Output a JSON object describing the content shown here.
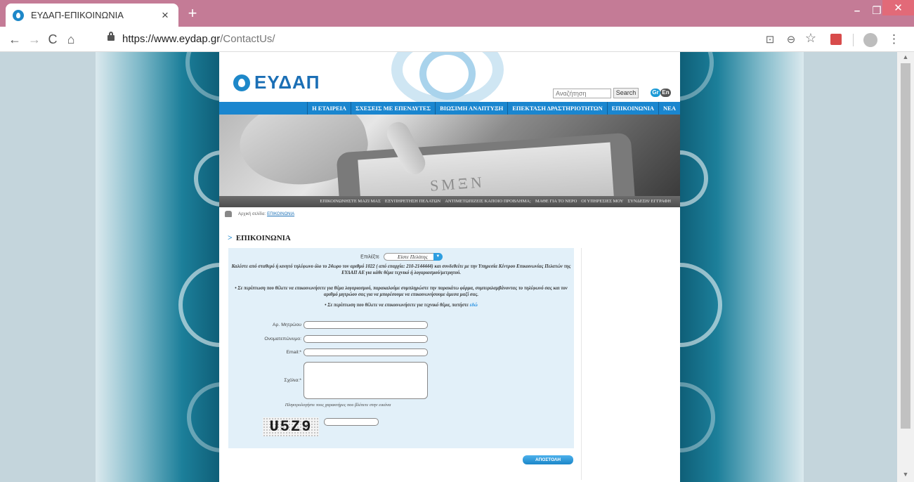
{
  "browser": {
    "tab_title": "ΕΥΔΑΠ-ΕΠΙΚΟΙΝΩΝΙΑ",
    "tab_close": "×",
    "new_tab": "+",
    "url_host": "https://www.eydap.gr",
    "url_path": "/ContactUs/",
    "win_min": "–",
    "win_max": "❐",
    "win_close": "✕",
    "back": "←",
    "forward": "→",
    "reload": "C",
    "home": "⌂",
    "translate": "⊡",
    "zoom": "⊖",
    "star": "☆",
    "menu": "⋮"
  },
  "header": {
    "logo_text": "ΕΥΔΑΠ",
    "search_placeholder": "Αναζήτηση",
    "search_button": "Search",
    "lang_gr": "Gr",
    "lang_en": "En"
  },
  "main_nav": [
    "Η ΕΤΑΙΡΕΙΑ",
    "ΣΧΕΣΕΙΣ ΜΕ ΕΠΕΝΔΥΤΕΣ",
    "ΒΙΩΣΙΜΗ ΑΝΑΠΤΥΞΗ",
    "ΕΠΕΚΤΑΣΗ ΔΡΑΣΤΗΡΙΟΤΗΤΩΝ",
    "ΕΠΙΚΟΙΝΩΝΙΑ",
    "ΝΕΑ"
  ],
  "banner_text": "SMΞN",
  "sub_nav": [
    "ΕΠΙΚΟΙΝΩΝΗΣΤΕ ΜΑΖΙ ΜΑΣ",
    "ΕΞΥΠΗΡΕΤΗΣΗ ΠΕΛΑΤΩΝ",
    "ΑΝΤΙΜΕΤΩΠΙΖΕΙΣ ΚΑΠΟΙΟ ΠΡΟΒΛΗΜΑ;",
    "ΜΑΘΕ ΓΙΑ ΤΟ ΝΕΡΟ",
    "ΟΙ ΥΠΗΡΕΣΙΕΣ ΜΟΥ",
    "ΣΥΝΔΕΣΗ/ ΕΓΓΡΑΦΗ"
  ],
  "breadcrumb": {
    "prefix": "Αρχική σελίδα:",
    "current": "ΕΠΙΚΟΙΝΩΝΙΑ"
  },
  "page_title": "ΕΠΙΚΟΙΝΩΝΙΑ",
  "form": {
    "select_label": "Επιλέξτε",
    "select_value": "Είστε Πελάτης",
    "info_1": "Καλέστε από σταθερό ή κινητό τηλέφωνο όλο το 24ωρο τον αριθμό 1022 ( από επαρχία: 210-2144444) και συνδεθείτε με την Υπηρεσία Κέντρου Επικοινωνίας Πελατών της ΕΥΔΑΠ ΑΕ για κάθε θέμα τεχνικό ή λογαριασμού/μετρητού.",
    "info_2": "• Σε περίπτωση που θέλετε να επικοινωνήσετε για θέμα λογαριασμού, παρακαλούμε συμπληρώστε την παρακάτω φόρμα, συμπεριλαμβάνοντας το τηλέφωνό σας και τον αριθμό μητρώου σας για να μπορέσουμε να επικοινωνήσουμε άμεσα μαζί σας.",
    "info_3": "• Σε περίπτωση που θέλετε να επικοινωνήσετε για τεχνικό θέμα, πατήστε",
    "info_3_link": "εδώ",
    "label_registry": "Αρ. Μητρώου",
    "label_name": "Ονοματεπώνυμο:",
    "label_email": "Email:*",
    "label_comments": "Σχόλια:*",
    "captcha_hint": "Πληκτρολογήστε τους χαρακτήρες που βλέπετε στην εικόνα",
    "captcha_text": "U5Z9",
    "submit": "ΑΠΟΣΤΟΛΗ"
  }
}
